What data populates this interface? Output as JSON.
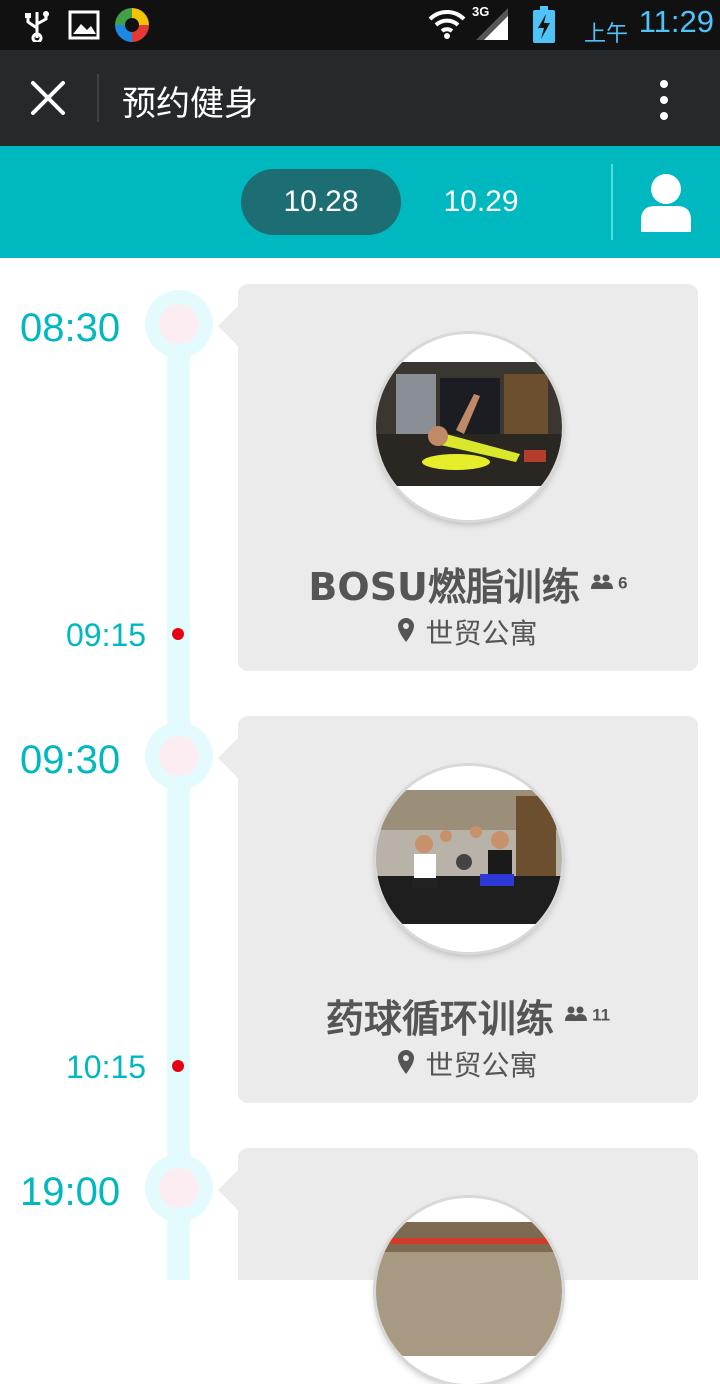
{
  "status_bar": {
    "ampm": "上午",
    "clock": "11:29",
    "network": "3G"
  },
  "header": {
    "title": "预约健身"
  },
  "dates": [
    {
      "label": "10.28",
      "active": true
    },
    {
      "label": "10.29",
      "active": false
    }
  ],
  "colors": {
    "accent": "#00b8bf",
    "dark_pill": "#1d6e72",
    "end_dot": "#e60012",
    "card_bg": "#ebebeb",
    "header_bg": "#26292b"
  },
  "classes": [
    {
      "start": "08:30",
      "end": "09:15",
      "name": "BOSU燃脂训练",
      "count": "6",
      "location": "世贸公寓"
    },
    {
      "start": "09:30",
      "end": "10:15",
      "name": "药球循环训练",
      "count": "11",
      "location": "世贸公寓"
    },
    {
      "start": "19:00"
    }
  ]
}
